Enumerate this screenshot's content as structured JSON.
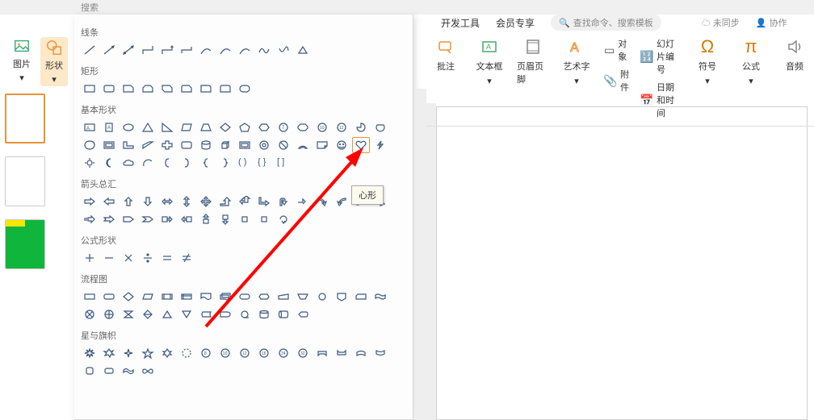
{
  "top_bar": {
    "search_label": "搜索"
  },
  "ribbon_tabs": {
    "dev": "开发工具",
    "member": "会员专享",
    "search_placeholder": "查找命令、搜索模板",
    "unsynced": "未同步",
    "coop": "协作"
  },
  "ribbon_tools": {
    "annotate": "批注",
    "textbox": "文本框",
    "header_footer": "页眉页脚",
    "wordart": "艺术字",
    "object": "对象",
    "attachment": "附件",
    "slide_no": "幻灯片编号",
    "datetime": "日期和时间",
    "symbol": "符号",
    "formula": "公式",
    "audio": "音频"
  },
  "left_tools": {
    "image": "图片",
    "shape": "形状"
  },
  "shapes": {
    "sections": {
      "lines": "线条",
      "rects": "矩形",
      "basic": "基本形状",
      "arrows": "箭头总汇",
      "equations": "公式形状",
      "flowchart": "流程图",
      "stars": "星与旗帜"
    },
    "tooltip": "心形"
  }
}
